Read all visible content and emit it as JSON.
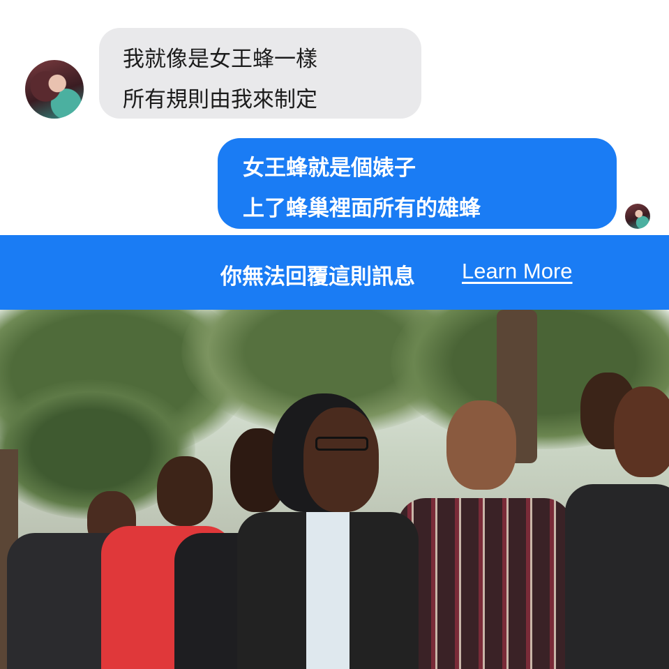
{
  "conversation": {
    "incoming": {
      "lines": [
        "我就像是女王蜂一樣",
        "所有規則由我來制定"
      ]
    },
    "outgoing": {
      "lines": [
        "女王蜂就是個婊子",
        "上了蜂巢裡面所有的雄蜂"
      ]
    }
  },
  "banner": {
    "message": "你無法回覆這則訊息",
    "link_label": "Learn More"
  },
  "colors": {
    "accent_blue": "#1a7cf4",
    "incoming_bubble": "#e9e9eb"
  }
}
